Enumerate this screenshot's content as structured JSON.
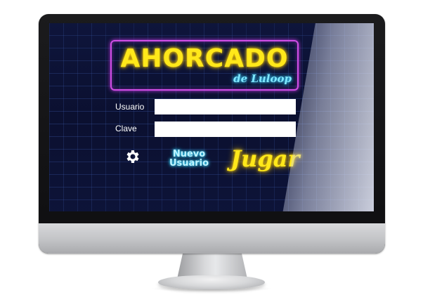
{
  "logo": {
    "title": "AHORCADO",
    "subtitle": "de Luloop"
  },
  "login": {
    "user_label": "Usuario",
    "user_value": "",
    "password_label": "Clave",
    "password_value": ""
  },
  "actions": {
    "settings_icon": "gear-icon",
    "new_user_label": "Nuevo Usuario",
    "play_label": "Jugar"
  },
  "colors": {
    "neon_yellow": "#ffe81a",
    "neon_cyan": "#7fe7ff",
    "neon_purple": "#d04ee6",
    "screen_bg": "#0b1030"
  }
}
